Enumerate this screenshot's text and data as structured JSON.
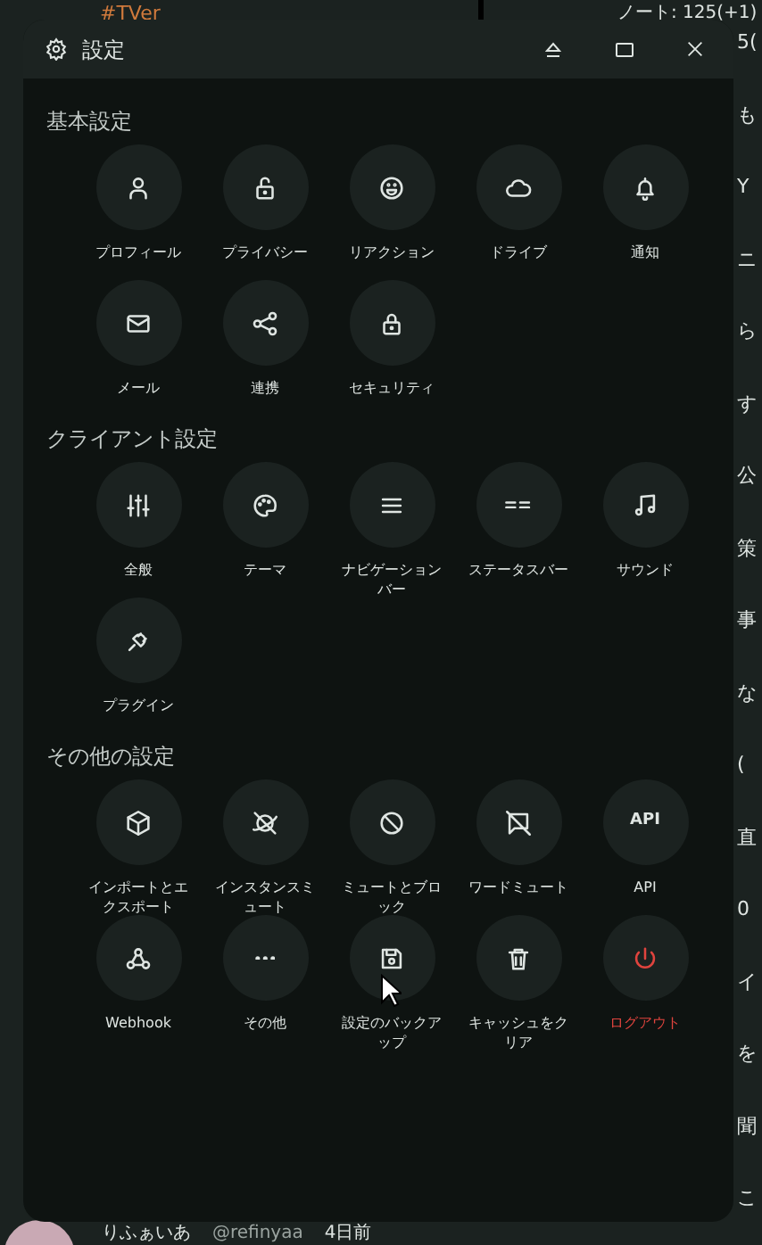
{
  "background": {
    "hashtag": "#TVer",
    "stats": "ノート: 125(+1)",
    "fragments": [
      "5(",
      "も",
      "Y",
      "ニ",
      "ら",
      "す",
      "公",
      "策",
      "事",
      "な",
      "(",
      "直",
      "0",
      "イ",
      "を",
      "聞",
      "こ"
    ],
    "author": {
      "name": "りふぁいあ",
      "handle": "@refinyaa",
      "time": "4日前"
    }
  },
  "window": {
    "title": "設定"
  },
  "sections": [
    {
      "title": "基本設定",
      "items": [
        {
          "label": "プロフィール",
          "kind": "normal"
        },
        {
          "label": "プライバシー",
          "kind": "normal"
        },
        {
          "label": "リアクション",
          "kind": "normal"
        },
        {
          "label": "ドライブ",
          "kind": "normal"
        },
        {
          "label": "通知",
          "kind": "normal"
        },
        {
          "label": "メール",
          "kind": "normal"
        },
        {
          "label": "連携",
          "kind": "normal"
        },
        {
          "label": "セキュリティ",
          "kind": "normal"
        }
      ]
    },
    {
      "title": "クライアント設定",
      "items": [
        {
          "label": "全般",
          "kind": "normal"
        },
        {
          "label": "テーマ",
          "kind": "normal"
        },
        {
          "label": "ナビゲーションバー",
          "kind": "normal"
        },
        {
          "label": "ステータスバー",
          "kind": "normal"
        },
        {
          "label": "サウンド",
          "kind": "normal"
        },
        {
          "label": "プラグイン",
          "kind": "normal"
        }
      ]
    },
    {
      "title": "その他の設定",
      "items": [
        {
          "label": "インポートとエクスポート",
          "kind": "normal"
        },
        {
          "label": "インスタンスミュート",
          "kind": "normal"
        },
        {
          "label": "ミュートとブロック",
          "kind": "normal"
        },
        {
          "label": "ワードミュート",
          "kind": "normal"
        },
        {
          "label": "API",
          "kind": "text-icon",
          "icon_text": "API"
        },
        {
          "label": "Webhook",
          "kind": "normal"
        },
        {
          "label": "その他",
          "kind": "normal"
        },
        {
          "label": "設定のバックアップ",
          "kind": "normal"
        },
        {
          "label": "キャッシュをクリア",
          "kind": "normal"
        },
        {
          "label": "ログアウト",
          "kind": "danger"
        }
      ]
    }
  ]
}
